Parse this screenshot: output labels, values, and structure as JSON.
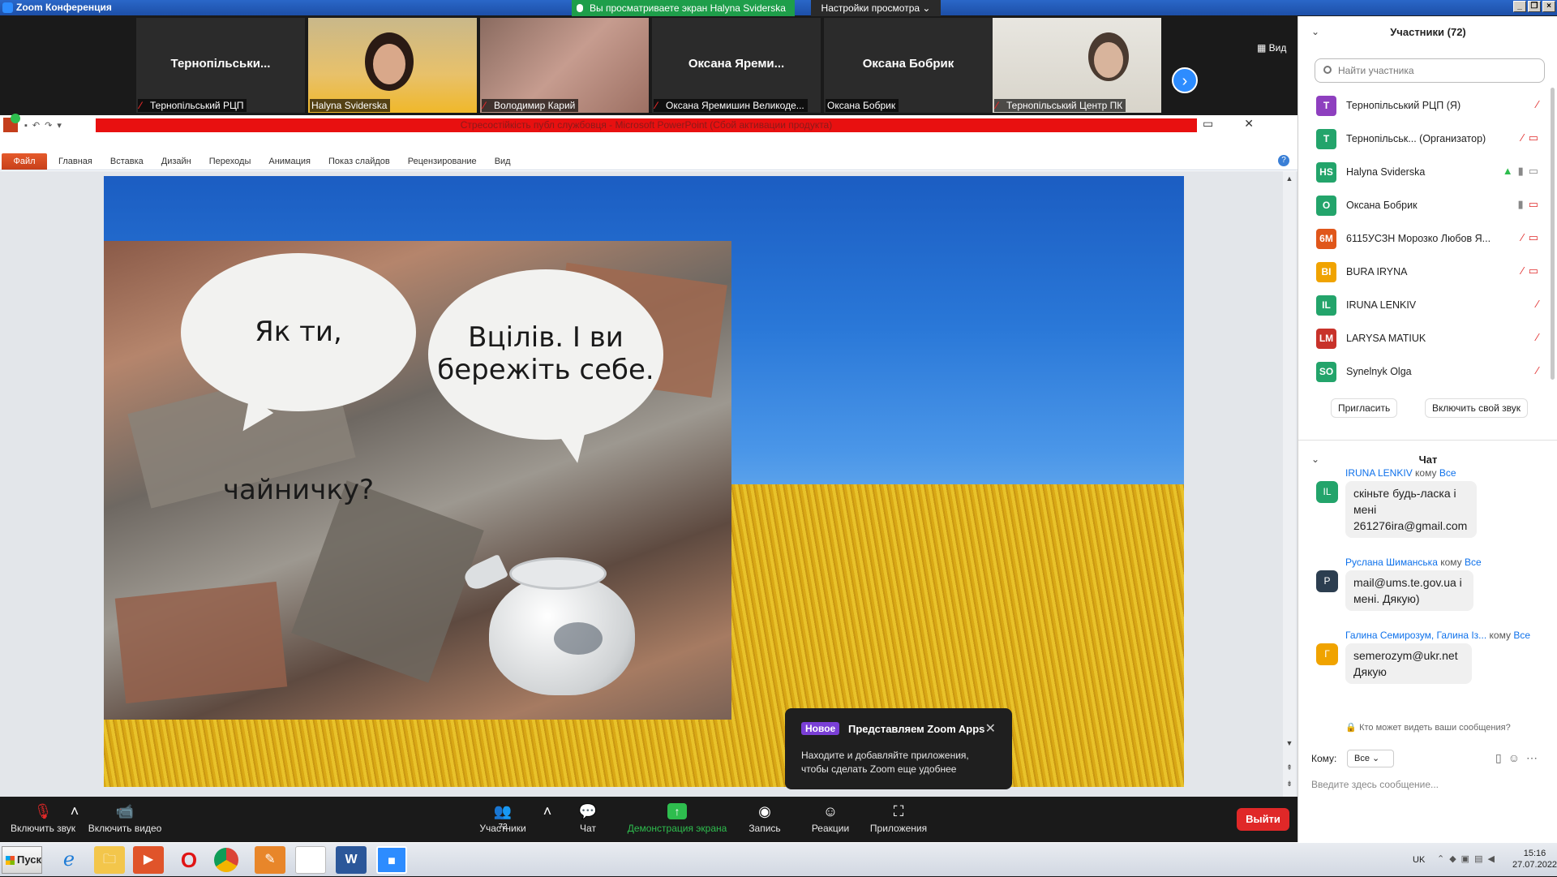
{
  "window": {
    "title": "Zoom Конференция",
    "share_banner": "Вы просматриваете экран Halyna Sviderska",
    "view_settings": "Настройки просмотра"
  },
  "gallery": {
    "view_label": "Вид",
    "tiles": [
      {
        "name": "Тернопільськи...",
        "label": "Тернопільський РЦП",
        "muted": true
      },
      {
        "name": "",
        "label": "Halyna Sviderska",
        "muted": false
      },
      {
        "name": "",
        "label": "Володимир Карий",
        "muted": true
      },
      {
        "name": "Оксана  Яреми...",
        "label": "Оксана Яремишин Великоде...",
        "muted": true
      },
      {
        "name": "Оксана Бобрик",
        "label": "Оксана Бобрик",
        "muted": false
      },
      {
        "name": "",
        "label": "Тернопільський Центр ПК",
        "muted": true
      }
    ]
  },
  "ppt": {
    "title": "Стресостійкість публ службовця  -  Microsoft PowerPoint (Сбой активации продукта)",
    "file_tab": "Файл",
    "tabs": [
      "Главная",
      "Вставка",
      "Дизайн",
      "Переходы",
      "Анимация",
      "Показ слайдов",
      "Рецензирование",
      "Вид"
    ],
    "slide": {
      "bubble1": "Як ти, чайничку?",
      "bubble2_line1": "Вцілів. І ви",
      "bubble2_line2": "бережіть себе."
    }
  },
  "toast": {
    "badge": "Новое",
    "title": "Представляем Zoom Apps",
    "body": "Находите и добавляйте приложения, чтобы сделать Zoom еще удобнее"
  },
  "toolbar": {
    "audio": "Включить звук",
    "video": "Включить видео",
    "participants": "Участники",
    "participants_count": "72",
    "chat": "Чат",
    "share": "Демонстрация экрана",
    "record": "Запись",
    "reactions": "Реакции",
    "apps": "Приложения",
    "leave": "Выйти"
  },
  "panel": {
    "participants_title": "Участники (72)",
    "search_placeholder": "Найти участника",
    "participants": [
      {
        "initials": "Т",
        "color": "#8e3fbf",
        "name": "Тернопільський РЦП (Я)",
        "status": "🎤"
      },
      {
        "initials": "Т",
        "color": "#23a46b",
        "name": "Тернопільськ...  (Организатор)",
        "status": "🎤 ▭"
      },
      {
        "initials": "HS",
        "color": "#23a46b",
        "name": "Halyna Sviderska",
        "status": "▲ 🎤 ▭"
      },
      {
        "initials": "О",
        "color": "#23a46b",
        "name": "Оксана Бобрик",
        "status": "🎤 ▭"
      },
      {
        "initials": "6М",
        "color": "#e0561a",
        "name": "6115УСЗН Морозко Любов Я...",
        "status": "🎤 ▭"
      },
      {
        "initials": "BI",
        "color": "#f0a300",
        "name": "BURA IRYNA",
        "status": "🎤 ▭"
      },
      {
        "initials": "IL",
        "color": "#23a46b",
        "name": "IRUNA LENKIV",
        "status": "🎤"
      },
      {
        "initials": "LM",
        "color": "#c8322a",
        "name": "LARYSA MATIUK",
        "status": "🎤"
      },
      {
        "initials": "SO",
        "color": "#23a46b",
        "name": "Synelnyk Olga",
        "status": "🎤"
      }
    ],
    "invite": "Пригласить",
    "unmute_me": "Включить свой звук",
    "chat_title": "Чат",
    "messages": [
      {
        "initials": "IL",
        "color": "#23a46b",
        "sender": "IRUNA LENKIV",
        "to": "кому",
        "target": "Все",
        "text": "скіньте будь-ласка і мені 261276ira@gmail.com"
      },
      {
        "initials": "Р",
        "color": "#2c3e50",
        "sender": "Руслана Шиманська",
        "to": "кому",
        "target": "Все",
        "text": "mail@ums.te.gov.ua і мені. Дякую)"
      },
      {
        "initials": "Г",
        "color": "#f0a300",
        "sender": "Галина Семирозум, Галина Із...",
        "to": "кому",
        "target": "Все",
        "text": "semerozym@ukr.net Дякую"
      }
    ],
    "who_can_see": "Кто может видеть ваши сообщения?",
    "to_label": "Кому:",
    "to_value": "Все",
    "input_placeholder": "Введите здесь сообщение..."
  },
  "taskbar": {
    "start": "Пуск",
    "lang": "UK",
    "time": "15:16",
    "date": "27.07.2022"
  }
}
